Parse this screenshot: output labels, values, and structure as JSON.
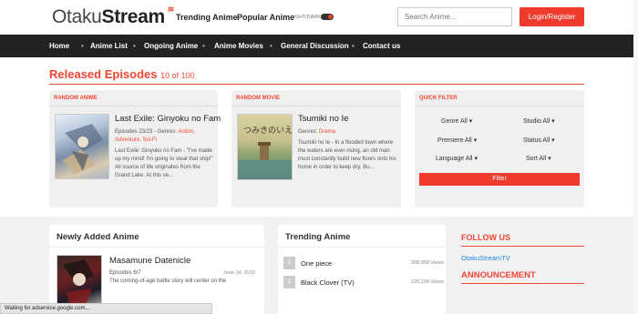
{
  "brand": {
    "part1": "Otaku",
    "part2": "Stream",
    "wifi": "≋"
  },
  "topnav": {
    "trending": "Trending Anime",
    "popular": "Popular Anime",
    "lightdark": "LIGHT/DARK"
  },
  "search": {
    "placeholder": "Search Anime..."
  },
  "login": "Login/Register",
  "nav": [
    "Home",
    "Anime List",
    "Ongoing Anime",
    "Anime Movies",
    "General Discussion",
    "Contact us"
  ],
  "released": {
    "title": "Released Episodes",
    "count": "10 of 100"
  },
  "random_anime": {
    "header": "RANDOM ANIME",
    "title": "Last Exile: Ginyoku no Fam",
    "episodes": "Episodes 23/23 - Genres:",
    "genres": "Action, Adventure, Sci-Fi",
    "desc": "Last Exile: Ginyoku no Fam - \"I've made up my mind! I'm going to steal that ship!\" All source of life originates from the Grand Lake. At this ve..."
  },
  "random_movie": {
    "header": "RANDOM MOVIE",
    "title": "Tsumiki no Ie",
    "genres_label": "Genres:",
    "genres": "Drama",
    "desc": "Tsumiki no Ie - In a flooded town where the waters are ever-rising, an old man must constantly build new floors onto his home in order to keep dry. Bu..."
  },
  "quick_filter": {
    "header": "QUICK FILTER",
    "genre": "Genre All",
    "studio": "Studio All",
    "premiere": "Premiere All",
    "status": "Status All",
    "language": "Language All",
    "sort": "Sort All",
    "button": "Filter"
  },
  "newly_added": {
    "header": "Newly Added Anime",
    "title": "Masamune Datenicle",
    "episodes": "Episodes 6/7",
    "date": "June 14, 2019",
    "desc": "The coming-of-age battle story will center on the"
  },
  "trending": {
    "header": "Trending Anime",
    "items": [
      {
        "num": "1",
        "name": "One piece",
        "views": "308,958 Views"
      },
      {
        "num": "2",
        "name": "Black Clover (TV)",
        "views": "220,234 Views"
      }
    ]
  },
  "sidebar": {
    "follow": "FOLLOW US",
    "twitter": "OtakuStreamTV",
    "announcement": "ANNOUNCEMENT"
  },
  "statusbar": "Waiting for adservice.google.com..."
}
